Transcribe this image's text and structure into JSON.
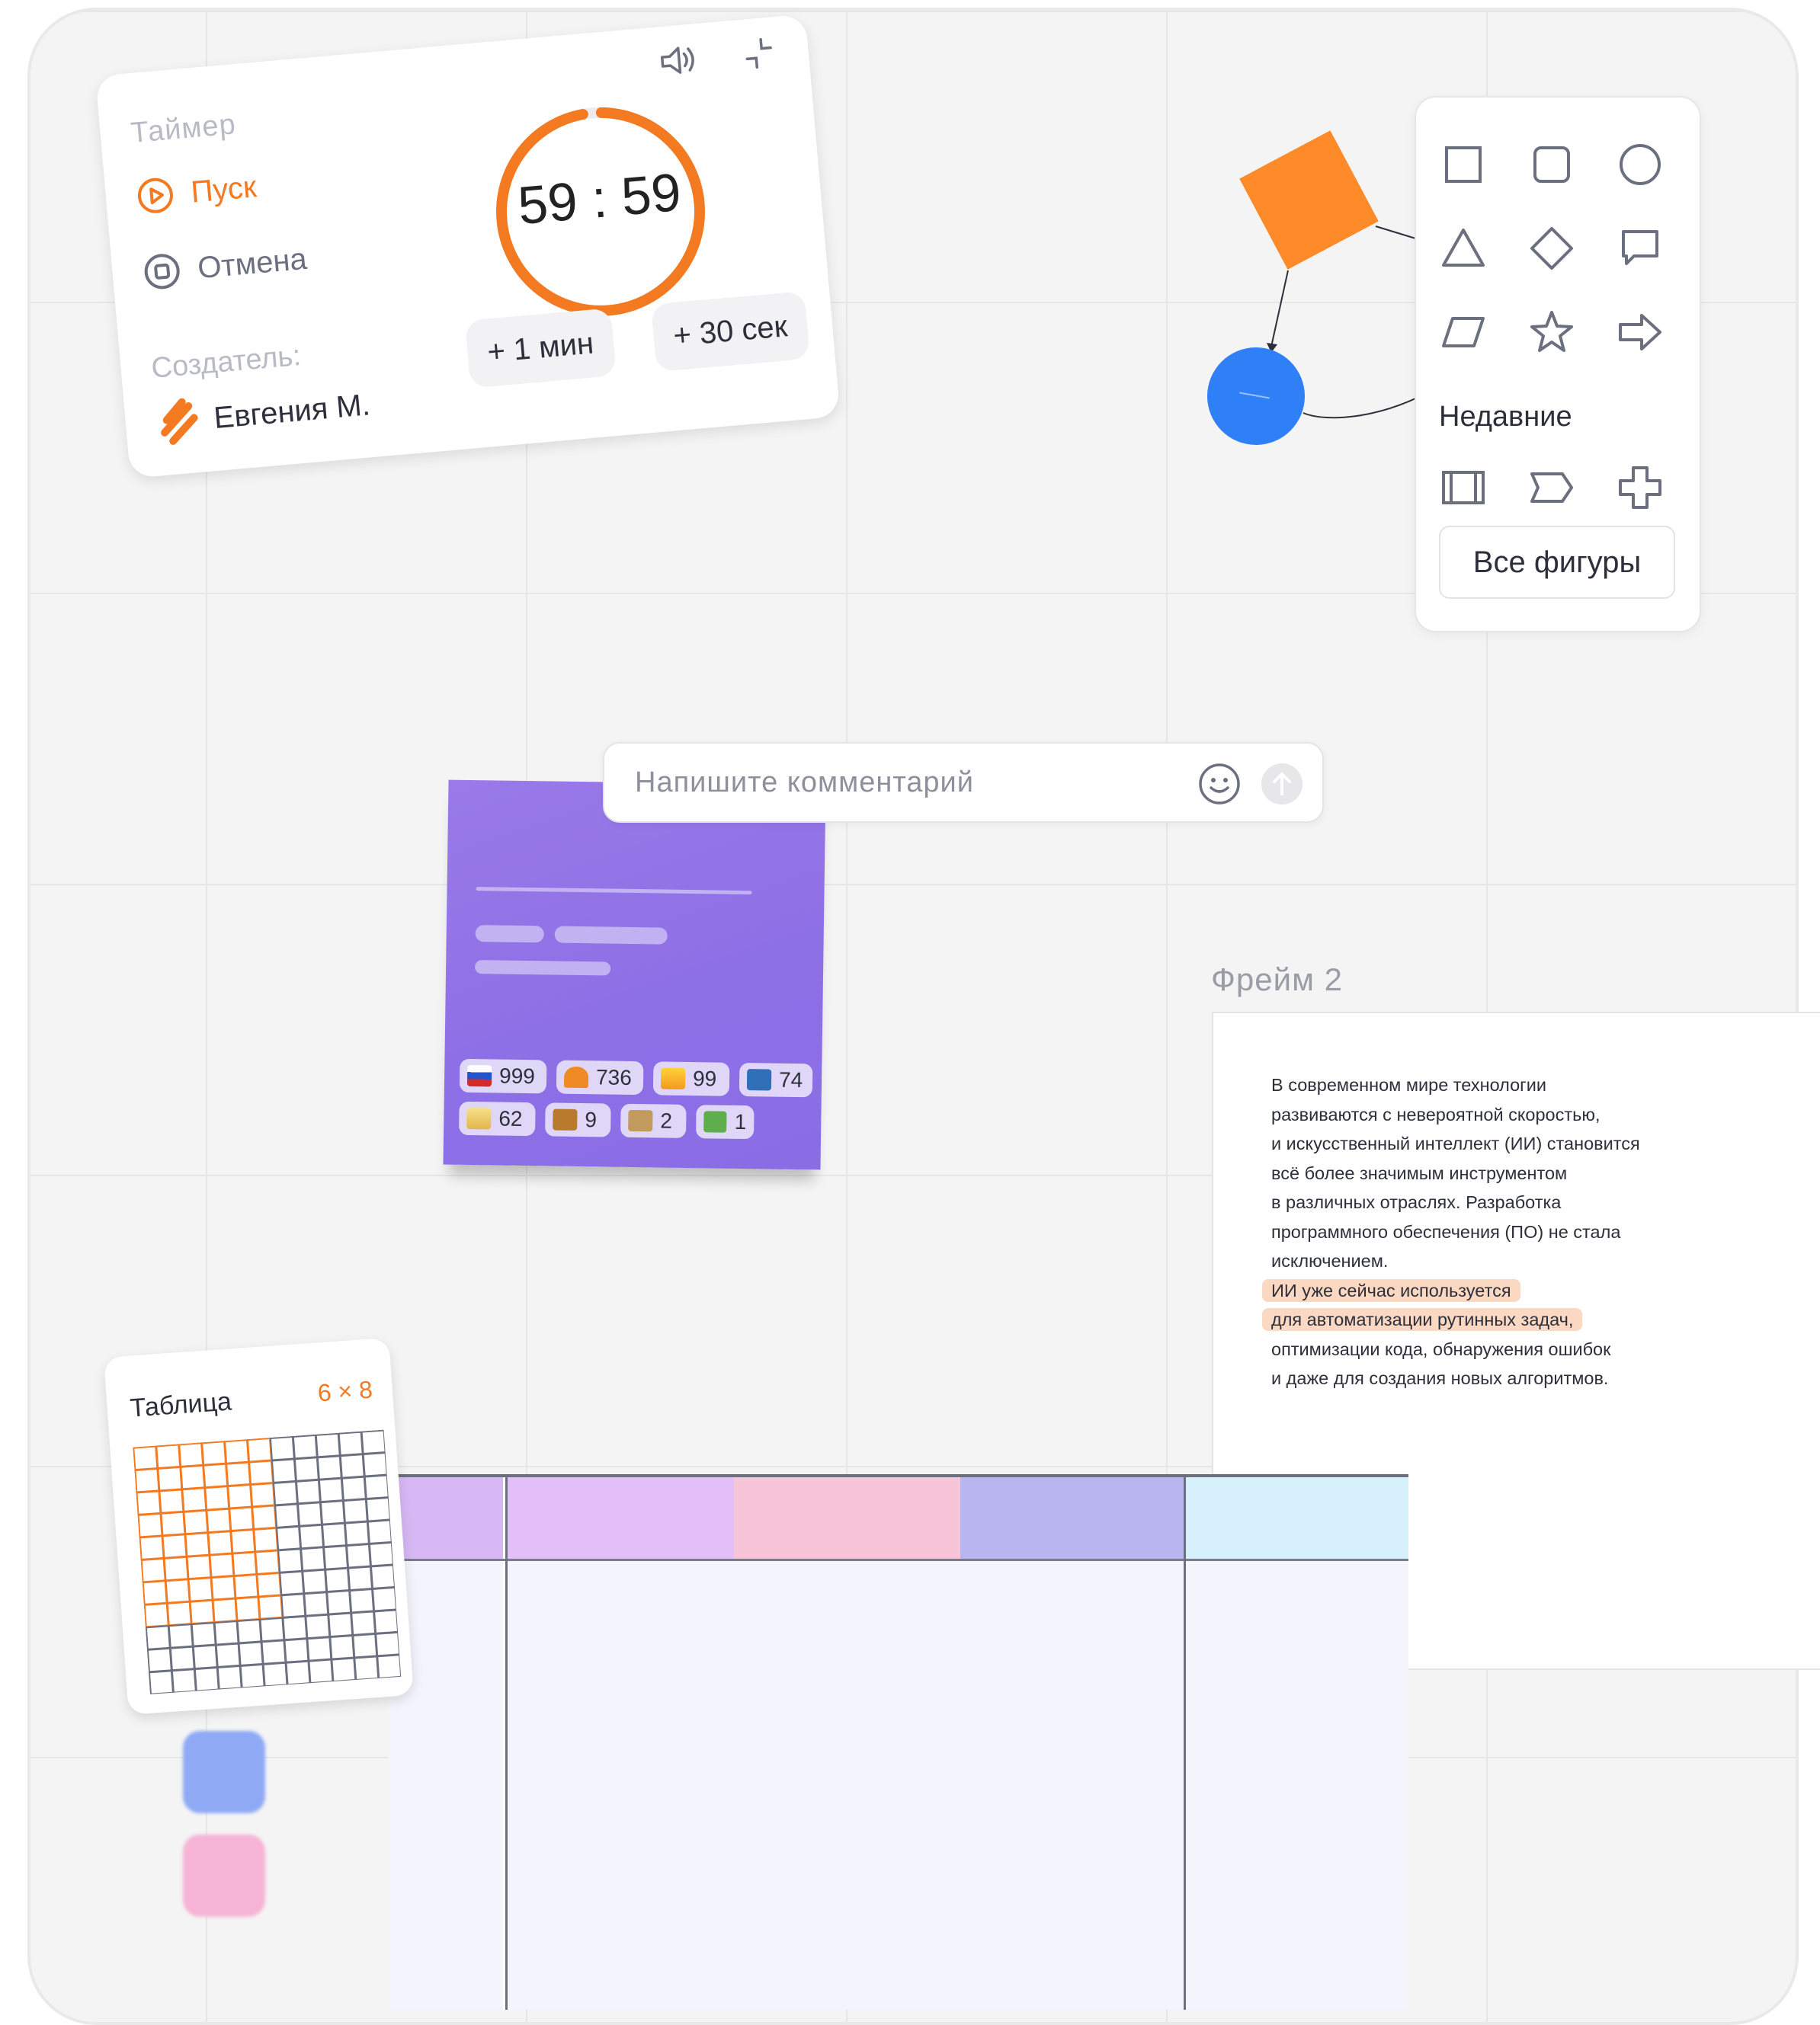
{
  "timer": {
    "title": "Таймер",
    "start_label": "Пуск",
    "cancel_label": "Отмена",
    "creator_label": "Создатель:",
    "creator_name": "Евгения М.",
    "time": "59 : 59",
    "progress": 0.97,
    "add_minute_label": "+ 1 мин",
    "add_30sec_label": "+ 30 сек",
    "accent_color": "#f47a22"
  },
  "shapes_panel": {
    "shapes": [
      "square",
      "rounded-square",
      "circle",
      "triangle",
      "diamond",
      "speech-bubble",
      "parallelogram",
      "star",
      "arrow-right"
    ],
    "recent_label": "Недавние",
    "recent_shapes": [
      "predefined-process",
      "chevron",
      "cross"
    ],
    "all_shapes_label": "Все фигуры"
  },
  "diagram": {
    "diamond_color": "#ff8a2a",
    "circle_color": "#2f80f6"
  },
  "comment": {
    "placeholder": "Напишите комментарий"
  },
  "sticky": {
    "color": "#9177e8",
    "reactions": [
      {
        "icon": "russia-flag",
        "count": "999"
      },
      {
        "icon": "heart",
        "count": "736"
      },
      {
        "icon": "fire",
        "count": "99"
      },
      {
        "icon": "book",
        "count": "74"
      },
      {
        "icon": "cake",
        "count": "62"
      },
      {
        "icon": "trophy",
        "count": "9"
      },
      {
        "icon": "palette",
        "count": "2"
      },
      {
        "icon": "frog",
        "count": "1"
      }
    ]
  },
  "frame": {
    "label": "Фрейм 2",
    "lines": [
      "В современном мире технологии",
      "развиваются с невероятной скоростью,",
      "и искусственный интеллект (ИИ) становится",
      "всё более значимым инструментом",
      "в различных отраслях. Разработка",
      "программного обеспечения (ПО) не стала",
      "исключением.",
      "ИИ уже сейчас используется",
      "для автоматизации рутинных задач,",
      "оптимизации кода, обнаружения ошибок",
      "и даже для создания новых алгоритмов."
    ],
    "highlight_color": "#fbd8c2"
  },
  "table_card": {
    "title": "Таблица",
    "size": "6 × 8"
  },
  "kanban": {
    "columns": [
      {
        "color": "#d7b8f5"
      },
      {
        "color": "#e3bff8"
      },
      {
        "color": "#f8c4d8"
      },
      {
        "color": "#b9b5ee"
      },
      {
        "color": "#d6f1fb"
      }
    ]
  },
  "swatches": [
    "#8fa9f5",
    "#f6b4d6"
  ]
}
